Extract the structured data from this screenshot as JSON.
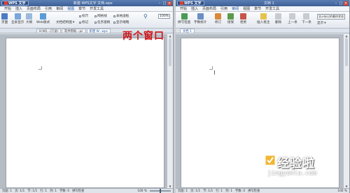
{
  "left_window": {
    "app_name": "WPS 文字",
    "doc_title": "新建 WPS文字 文档.wps",
    "menu": [
      "开始",
      "插入",
      "页面布局",
      "引用",
      "审阅",
      "视图",
      "章节",
      "开发工具"
    ],
    "tools": {
      "page_view": "页面",
      "full_screen": "全屏显示",
      "outline": "大纲",
      "web_layout": "Web版式",
      "doc_structure": "文档结构图",
      "ruler": "标尺",
      "grid": "网格线",
      "table_gridlines": "表格虚框",
      "mark": "标记",
      "task_pane": "任务窗格",
      "thumbnail": "显示缩略",
      "zoom": "100%"
    },
    "tabs": [
      "H.NQ...(只读)",
      "软件帮助...pc",
      "新建 W...wps"
    ],
    "status": {
      "page": "页面: 1",
      "pages": "页: 1/1",
      "section": "节: 1/1",
      "line": "行: 1",
      "column": "列: 1",
      "words": "字数: 0",
      "spell": "拼写检查",
      "zoom": "100 %"
    }
  },
  "right_window": {
    "app_name": "WPS 文字",
    "doc_title": "文档 1",
    "menu": [
      "开始",
      "插入",
      "页面布局",
      "引用",
      "审阅",
      "视图",
      "章节",
      "开发工具"
    ],
    "tools": {
      "spell_check": "拼写检查",
      "word_count": "字数统计",
      "revise": "修订",
      "accept": "接受",
      "reject": "拒绝",
      "insert_comment": "插入批注",
      "delete": "删除",
      "previous": "上一条",
      "next": "下一条",
      "show_markup": "显示标记的最终状态",
      "show": "显示"
    },
    "tabs": [
      "文档 1"
    ],
    "status": {
      "page": "页面: 1",
      "pages": "页: 1/1",
      "section": "节: 1/1",
      "line": "行: 1",
      "column": "列: 1",
      "words": "字数: 0",
      "spell": "拼写检查",
      "zoom": "100 %"
    }
  },
  "annotation": "两个窗口",
  "watermark": {
    "text": "经验啦",
    "url": "jingyanla.com"
  },
  "colors": {
    "title_bar": "#3d5f95",
    "annotation_red": "#d0161a",
    "logo_red": "#e63b2e"
  }
}
